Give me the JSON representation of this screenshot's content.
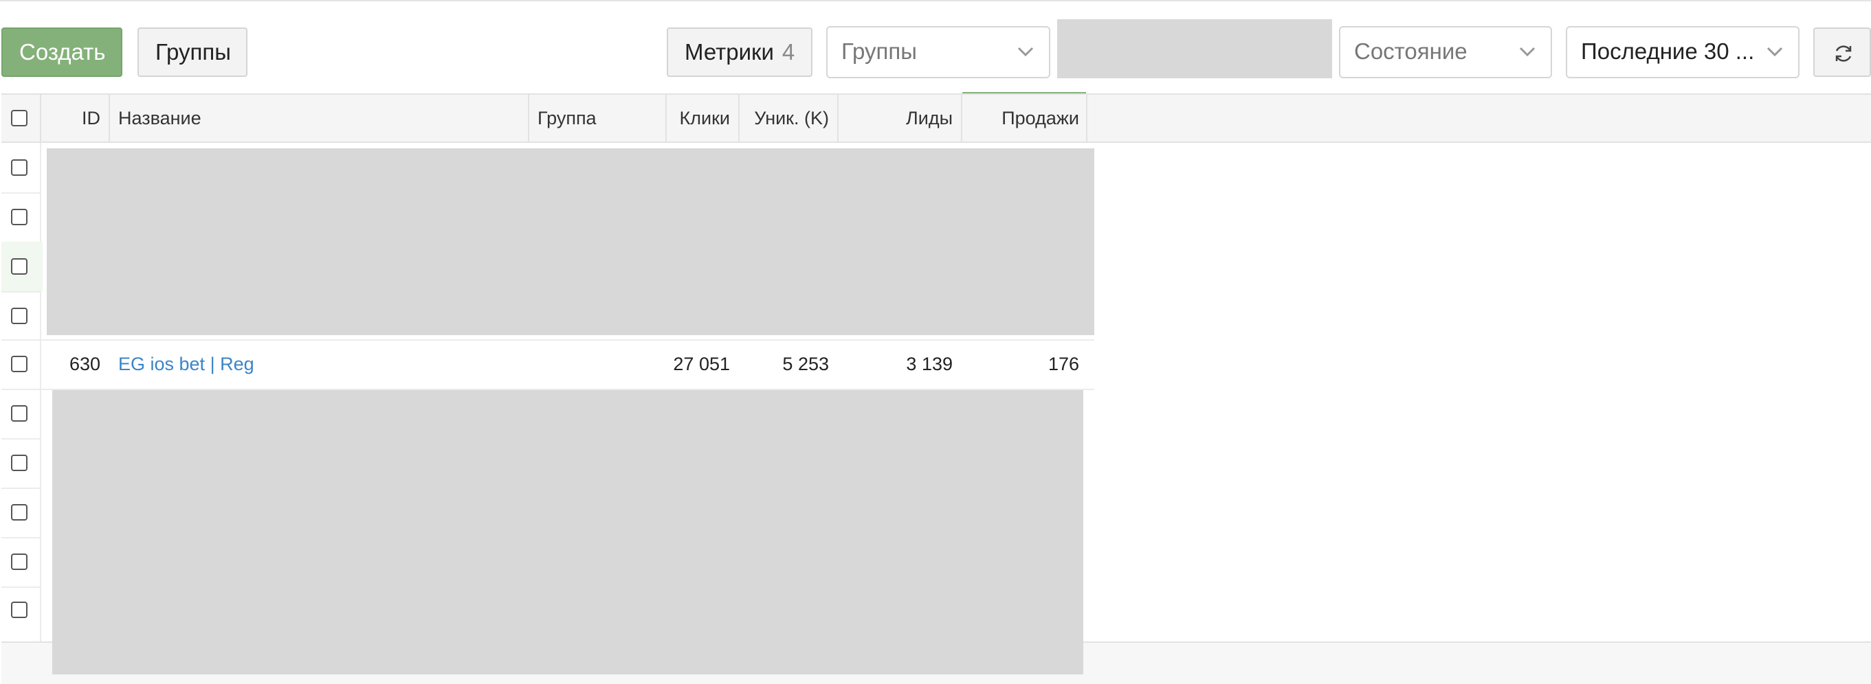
{
  "toolbar": {
    "create_label": "Создать",
    "groups_button_label": "Группы",
    "metrics_label": "Метрики",
    "metrics_count": "4",
    "groups_select_placeholder": "Группы",
    "state_select_placeholder": "Состояние",
    "period_select_value": "Последние 30 ...",
    "refresh_icon": "refresh-icon",
    "chevron_icon": "chevron-down-icon"
  },
  "table": {
    "columns": {
      "id": "ID",
      "name": "Название",
      "group": "Группа",
      "clicks": "Клики",
      "uniq": "Уник. (K)",
      "leads": "Лиды",
      "sales": "Продажи"
    },
    "sorted_column": "Продажи",
    "visible_row": {
      "id": "630",
      "name": "EG ios bet | Reg",
      "group": "",
      "clicks": "27 051",
      "uniq": "5 253",
      "leads": "3 139",
      "sales": "176"
    }
  },
  "colors": {
    "primary": "#84b179",
    "link": "#3a84c9",
    "redaction": "#d8d8d8"
  }
}
